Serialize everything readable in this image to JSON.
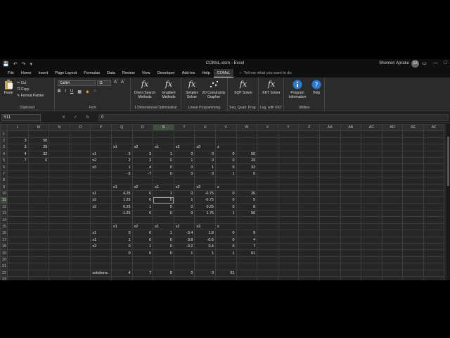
{
  "titlebar": {
    "title": "COMsL.xlsm - Excel",
    "user": "Shemen Apraku",
    "initials": "SA"
  },
  "menu": {
    "tabs": [
      "File",
      "Home",
      "Insert",
      "Page Layout",
      "Formulas",
      "Data",
      "Review",
      "View",
      "Developer",
      "Add-ins",
      "Help",
      "COMsL"
    ],
    "active": "COMsL",
    "tell_me": "Tell me what you want to do"
  },
  "ribbon": {
    "clipboard": {
      "paste": "Paste",
      "cut": "Cut",
      "copy": "Copy",
      "format_painter": "Format Painter",
      "label": "Clipboard"
    },
    "font": {
      "name": "Calibri",
      "size": "11",
      "label": "Font"
    },
    "one_dim": {
      "btn1": "Direct Search Methods",
      "btn2": "Gradient Methods",
      "label": "1 Dimensional Optimization"
    },
    "linear": {
      "btn1": "Simplex Solver",
      "btn2": "2D Constraints Grapher",
      "label": "Linear Programming"
    },
    "sqp": {
      "btn": "SQP Solver",
      "label": "Seq. Quad. Prog."
    },
    "kkt": {
      "btn": "KKT Solver",
      "label": "Lag. with KKT"
    },
    "utilities": {
      "btn1": "Program Information",
      "btn2": "Help",
      "label": "Utilities"
    }
  },
  "formula_bar": {
    "name_box": "S11",
    "formula": "0"
  },
  "sheet": {
    "columns": [
      "L",
      "M",
      "N",
      "O",
      "P",
      "Q",
      "R",
      "S",
      "T",
      "U",
      "V",
      "W",
      "X",
      "Y",
      "Z",
      "AA",
      "AB",
      "AC",
      "AD",
      "AE",
      "AF"
    ],
    "selected_column": "S",
    "selected_row": "11",
    "rows": [
      {
        "n": "1",
        "c": {}
      },
      {
        "n": "2",
        "c": {
          "L": "3",
          "M": "50"
        }
      },
      {
        "n": "3",
        "c": {
          "L": "3",
          "M": "29",
          "Q": "x1",
          "R": "x2",
          "S": "s1",
          "T": "s2",
          "U": "s3",
          "V": "z"
        }
      },
      {
        "n": "4",
        "c": {
          "L": "4",
          "M": "32",
          "P": "s1",
          "Q": "5",
          "R": "3",
          "S": "1",
          "T": "0",
          "U": "0",
          "V": "0",
          "W": "50"
        }
      },
      {
        "n": "5",
        "c": {
          "L": "7",
          "M": "0",
          "P": "s2",
          "Q": "2",
          "R": "3",
          "S": "0",
          "T": "1",
          "U": "0",
          "V": "0",
          "W": "29"
        }
      },
      {
        "n": "6",
        "c": {
          "P": "s3",
          "Q": "1",
          "R": "4",
          "S": "0",
          "T": "0",
          "U": "1",
          "V": "0",
          "W": "32"
        }
      },
      {
        "n": "7",
        "c": {
          "Q": "-3",
          "R": "-7",
          "S": "0",
          "T": "0",
          "U": "0",
          "V": "1",
          "W": "0"
        }
      },
      {
        "n": "8",
        "c": {}
      },
      {
        "n": "9",
        "c": {
          "Q": "x1",
          "R": "x2",
          "S": "s1",
          "T": "s2",
          "U": "s3",
          "V": "z"
        }
      },
      {
        "n": "10",
        "c": {
          "P": "s1",
          "Q": "4.25",
          "R": "0",
          "S": "1",
          "T": "0",
          "U": "-0.75",
          "V": "0",
          "W": "26"
        }
      },
      {
        "n": "11",
        "c": {
          "P": "s2",
          "Q": "1.25",
          "R": "0",
          "S": "0",
          "T": "1",
          "U": "-0.75",
          "V": "0",
          "W": "5"
        }
      },
      {
        "n": "12",
        "c": {
          "P": "x2",
          "Q": "0.25",
          "R": "1",
          "S": "0",
          "T": "0",
          "U": "0.25",
          "V": "0",
          "W": "8"
        }
      },
      {
        "n": "13",
        "c": {
          "Q": "-1.25",
          "R": "0",
          "S": "0",
          "T": "0",
          "U": "1.75",
          "V": "1",
          "W": "56"
        }
      },
      {
        "n": "14",
        "c": {}
      },
      {
        "n": "15",
        "c": {
          "Q": "x1",
          "R": "x2",
          "S": "s1",
          "T": "s2",
          "U": "s3",
          "V": "z"
        }
      },
      {
        "n": "16",
        "c": {
          "P": "s1",
          "Q": "0",
          "R": "0",
          "S": "1",
          "T": "-3.4",
          "U": "1.8",
          "V": "0",
          "W": "9"
        }
      },
      {
        "n": "17",
        "c": {
          "P": "x1",
          "Q": "1",
          "R": "0",
          "S": "0",
          "T": "0.8",
          "U": "-0.6",
          "V": "0",
          "W": "4"
        }
      },
      {
        "n": "18",
        "c": {
          "P": "x2",
          "Q": "0",
          "R": "1",
          "S": "0",
          "T": "-0.2",
          "U": "0.4",
          "V": "0",
          "W": "7"
        }
      },
      {
        "n": "19",
        "c": {
          "Q": "0",
          "R": "0",
          "S": "0",
          "T": "1",
          "U": "1",
          "V": "1",
          "W": "61"
        }
      },
      {
        "n": "20",
        "c": {}
      },
      {
        "n": "21",
        "c": {}
      },
      {
        "n": "22",
        "c": {
          "P": "solutions:",
          "Q": "4",
          "R": "7",
          "S": "9",
          "T": "0",
          "U": "0",
          "V": "61"
        }
      },
      {
        "n": "23",
        "c": {}
      }
    ]
  }
}
